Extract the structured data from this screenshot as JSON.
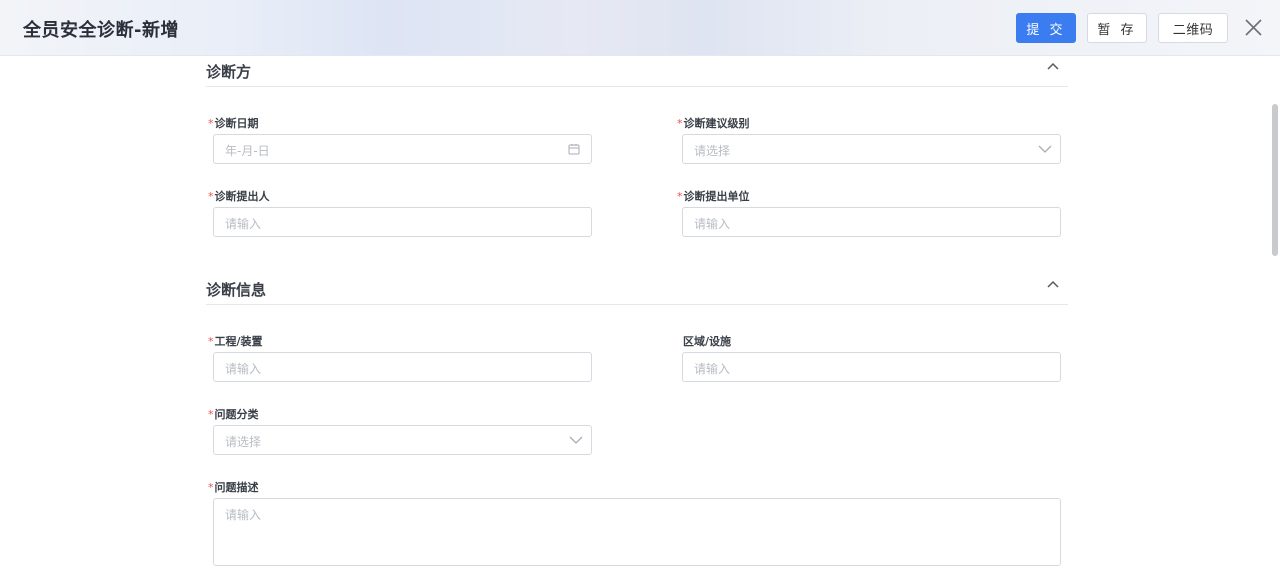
{
  "header": {
    "title": "全员安全诊断-新增",
    "submit_label": "提 交",
    "save_label": "暂 存",
    "qr_label": "二维码"
  },
  "sections": [
    {
      "title": "诊断方",
      "fields": [
        {
          "label": "诊断日期",
          "required": "*",
          "placeholder": "年-月-日"
        },
        {
          "label": "诊断建议级别",
          "required": "*",
          "placeholder": "请选择"
        },
        {
          "label": "诊断提出人",
          "required": "*",
          "placeholder": "请输入"
        },
        {
          "label": "诊断提出单位",
          "required": "*",
          "placeholder": "请输入"
        }
      ]
    },
    {
      "title": "诊断信息",
      "fields": [
        {
          "label": "工程/装置",
          "required": "*",
          "placeholder": "请输入"
        },
        {
          "label": "区域/设施",
          "required": "",
          "placeholder": "请输入"
        },
        {
          "label": "问题分类",
          "required": "*",
          "placeholder": "请选择"
        },
        {
          "label": "问题描述",
          "required": "*",
          "placeholder": "请输入"
        }
      ]
    }
  ],
  "colors": {
    "primary": "#3b7cf0",
    "required": "#f05050",
    "placeholder": "#b8bcc4"
  }
}
